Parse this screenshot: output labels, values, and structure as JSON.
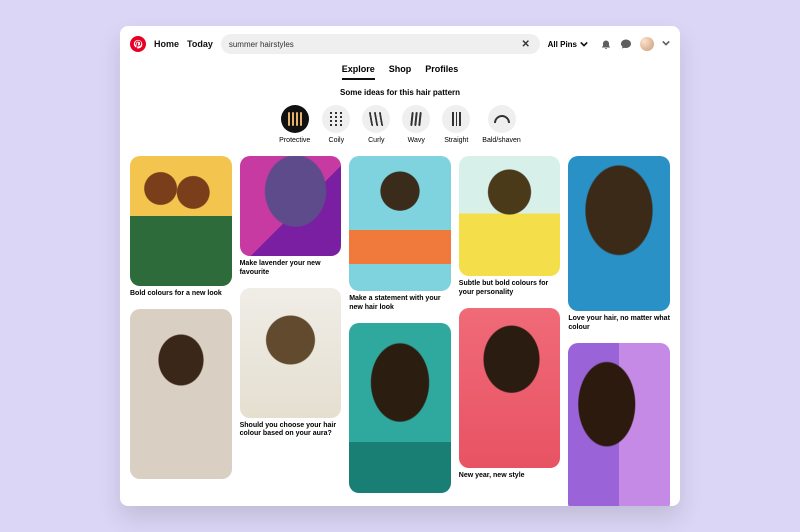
{
  "brand": {
    "color": "#e60023"
  },
  "nav": {
    "home": "Home",
    "today": "Today"
  },
  "search": {
    "query": "summer hairstyles",
    "scope": "All Pins"
  },
  "tabs": [
    {
      "label": "Explore",
      "active": true
    },
    {
      "label": "Shop",
      "active": false
    },
    {
      "label": "Profiles",
      "active": false
    }
  ],
  "subtitle": "Some ideas for this hair pattern",
  "patterns": [
    {
      "label": "Protective",
      "active": true
    },
    {
      "label": "Coily",
      "active": false
    },
    {
      "label": "Curly",
      "active": false
    },
    {
      "label": "Wavy",
      "active": false
    },
    {
      "label": "Straight",
      "active": false
    },
    {
      "label": "Bald/shaven",
      "active": false
    }
  ],
  "pins": [
    {
      "caption": "Bold colours for a new look"
    },
    {
      "caption": "Make lavender your new favourite"
    },
    {
      "caption": "Make a statement with your new hair look"
    },
    {
      "caption": "Subtle but bold colours for your personality"
    },
    {
      "caption": "Love your hair, no matter what colour"
    },
    {
      "caption": ""
    },
    {
      "caption": "Should you choose your hair colour based on your aura?"
    },
    {
      "caption": ""
    },
    {
      "caption": "New year, new style"
    },
    {
      "caption": ""
    }
  ]
}
